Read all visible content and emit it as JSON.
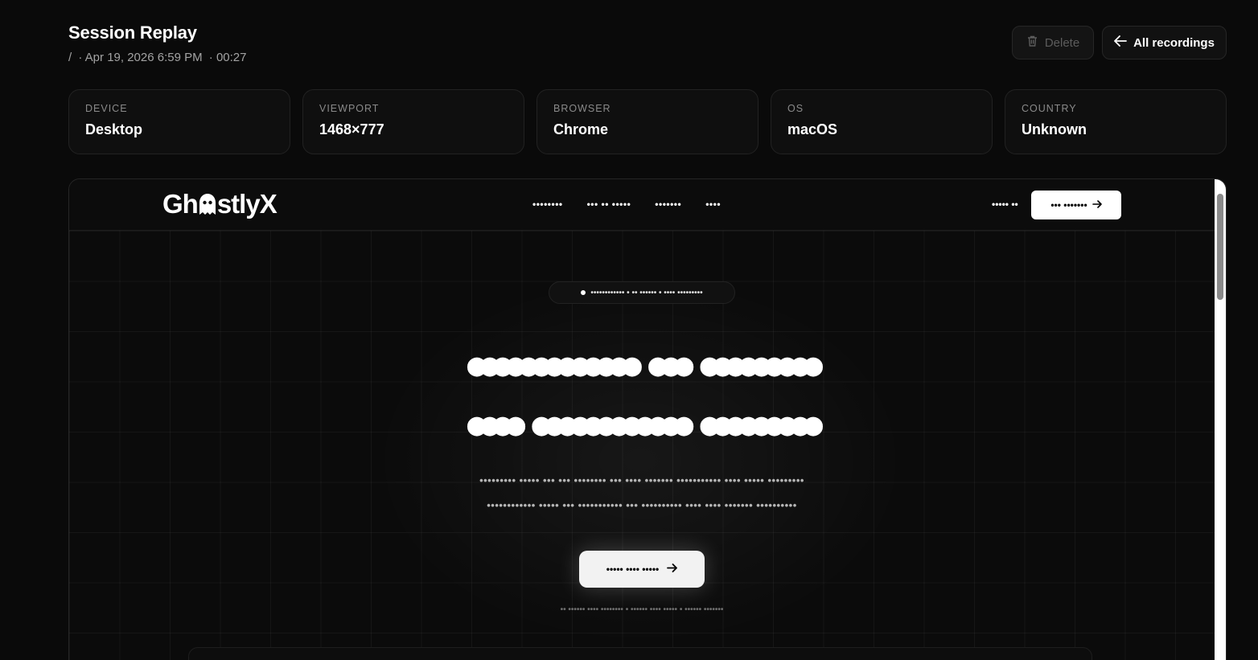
{
  "header": {
    "title": "Session Replay",
    "separator": "/",
    "datetime": "· Apr 19, 2026 6:59 PM",
    "duration": "· 00:27",
    "delete_label": "Delete",
    "all_recordings_label": "All recordings"
  },
  "info": {
    "device": {
      "label": "DEVICE",
      "value": "Desktop"
    },
    "viewport": {
      "label": "VIEWPORT",
      "value": "1468×777"
    },
    "browser": {
      "label": "BROWSER",
      "value": "Chrome"
    },
    "os": {
      "label": "OS",
      "value": "macOS"
    },
    "country": {
      "label": "COUNTRY",
      "value": "Unknown"
    }
  },
  "replay": {
    "logo_left": "Gh",
    "logo_right": "stlyX",
    "nav": [
      "••••••••",
      "••• •• •••••",
      "•••••••",
      "••••"
    ],
    "sign_in": "••••• ••",
    "cta": "••• •••••••",
    "pill": "•••••••••••• • •• •••••• • •••• •••••••••",
    "hero_line1": "●●●●●●●●●●●●● ●●● ●●●●●●●●●",
    "hero_line2": "●●●● ●●●●●●●●●●●● ●●●●●●●●●",
    "sub_line1": "••••••••• ••••• ••• ••• •••••••• ••• •••• ••••••• ••••••••••• •••• ••••• •••••••••",
    "sub_line2": "•••••••••••• ••••• ••• ••••••••••• ••• •••••••••• •••• •••• ••••••• ••••••••••",
    "hero_button": "••••• •••• •••••",
    "note": "•• •••••• •••• •••••••• • •••••• •••• ••••• • •••••• •••••••"
  }
}
